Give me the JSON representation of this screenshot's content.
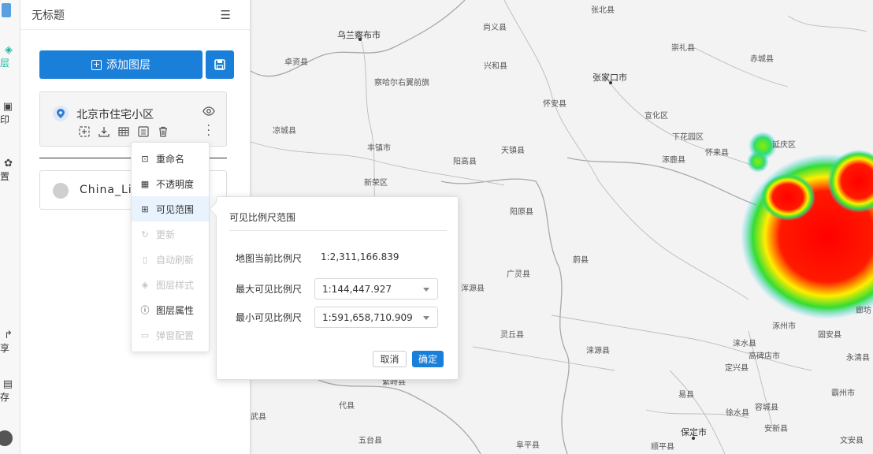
{
  "map": {
    "cities": [
      {
        "name": "张北县",
        "big": false
      },
      {
        "name": "尚义县",
        "big": false
      },
      {
        "name": "乌兰察布市",
        "big": true
      },
      {
        "name": "崇礼县",
        "big": false
      },
      {
        "name": "卓资县",
        "big": false
      },
      {
        "name": "兴和县",
        "big": false
      },
      {
        "name": "赤城县",
        "big": false
      },
      {
        "name": "张家口市",
        "big": true
      },
      {
        "name": "察哈尔右翼前旗",
        "big": false
      },
      {
        "name": "怀安县",
        "big": false
      },
      {
        "name": "宣化区",
        "big": false
      },
      {
        "name": "凉城县",
        "big": false
      },
      {
        "name": "下花园区",
        "big": false
      },
      {
        "name": "延庆区",
        "big": false
      },
      {
        "name": "怀来县",
        "big": false
      },
      {
        "name": "丰镇市",
        "big": false
      },
      {
        "name": "天镇县",
        "big": false
      },
      {
        "name": "涿鹿县",
        "big": false
      },
      {
        "name": "阳高县",
        "big": false
      },
      {
        "name": "新荣区",
        "big": false
      },
      {
        "name": "阳原县",
        "big": false
      },
      {
        "name": "蔚县",
        "big": false
      },
      {
        "name": "广灵县",
        "big": false
      },
      {
        "name": "涞源县",
        "big": false
      },
      {
        "name": "灵丘县",
        "big": false
      },
      {
        "name": "涿州市",
        "big": false
      },
      {
        "name": "固安县",
        "big": false
      },
      {
        "name": "廊坊",
        "big": false
      },
      {
        "name": "涞水县",
        "big": false
      },
      {
        "name": "高碑店市",
        "big": false
      },
      {
        "name": "永清县",
        "big": false
      },
      {
        "name": "定兴县",
        "big": false
      },
      {
        "name": "易县",
        "big": false
      },
      {
        "name": "霸州市",
        "big": false
      },
      {
        "name": "代县",
        "big": false
      },
      {
        "name": "繁峙县",
        "big": false
      },
      {
        "name": "徐水县",
        "big": false
      },
      {
        "name": "容城县",
        "big": false
      },
      {
        "name": "安新县",
        "big": false
      },
      {
        "name": "保定市",
        "big": true
      },
      {
        "name": "阜平县",
        "big": false
      },
      {
        "name": "顺平县",
        "big": false
      },
      {
        "name": "文安县",
        "big": false
      },
      {
        "name": "五台县",
        "big": false
      },
      {
        "name": "浑源县",
        "big": false
      },
      {
        "name": "武县",
        "big": false
      }
    ]
  },
  "nav": {
    "items": [
      {
        "label": "层",
        "icon": "layers-icon",
        "glyph": "◈",
        "active": true
      },
      {
        "label": "印",
        "icon": "print-icon",
        "glyph": "▣",
        "active": false
      },
      {
        "label": "置",
        "icon": "settings-icon",
        "glyph": "✿",
        "active": false
      },
      {
        "label": "享",
        "icon": "share-icon",
        "glyph": "↱",
        "active": false
      },
      {
        "label": "存",
        "icon": "save-icon",
        "glyph": "▤",
        "active": false
      }
    ]
  },
  "panel": {
    "title": "无标题",
    "add_layer_label": "添加图层",
    "layers": [
      {
        "name": "北京市住宅小区"
      },
      {
        "name": "China_Li"
      }
    ]
  },
  "context_menu": {
    "items": [
      {
        "label": "重命名",
        "icon": "rename-icon",
        "glyph": "⊡",
        "disabled": false,
        "selected": false
      },
      {
        "label": "不透明度",
        "icon": "opacity-icon",
        "glyph": "▦",
        "disabled": false,
        "selected": false
      },
      {
        "label": "可见范围",
        "icon": "visible-range-icon",
        "glyph": "⊞",
        "disabled": false,
        "selected": true
      },
      {
        "label": "更新",
        "icon": "refresh-icon",
        "glyph": "↻",
        "disabled": true,
        "selected": false
      },
      {
        "label": "自动刷新",
        "icon": "auto-refresh-icon",
        "glyph": "▯",
        "disabled": true,
        "selected": false
      },
      {
        "label": "图层样式",
        "icon": "layer-style-icon",
        "glyph": "◈",
        "disabled": true,
        "selected": false
      },
      {
        "label": "图层属性",
        "icon": "layer-properties-icon",
        "glyph": "ⓘ",
        "disabled": false,
        "selected": false
      },
      {
        "label": "弹窗配置",
        "icon": "popup-config-icon",
        "glyph": "▭",
        "disabled": true,
        "selected": false
      }
    ]
  },
  "scale_popover": {
    "title": "可见比例尺范围",
    "current_scale_label": "地图当前比例尺",
    "current_scale_value": "1:2,311,166.839",
    "max_scale_label": "最大可见比例尺",
    "max_scale_value": "1:144,447.927",
    "min_scale_label": "最小可见比例尺",
    "min_scale_value": "1:591,658,710.909",
    "cancel_label": "取消",
    "ok_label": "确定"
  },
  "colors": {
    "primary": "#1a7fd9",
    "accent": "#1db8a0",
    "heatmap_hot": "#ff1a00"
  }
}
